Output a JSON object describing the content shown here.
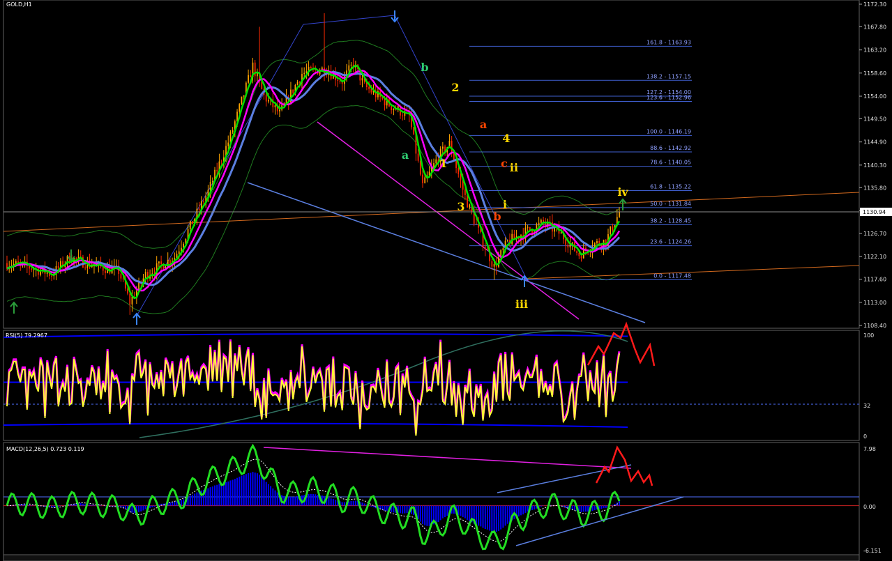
{
  "window": {
    "title": "GOLD,H1"
  },
  "current_price": "1130.94",
  "main": {
    "price_ticks": [
      "1172.30",
      "1167.80",
      "1163.20",
      "1158.60",
      "1154.00",
      "1149.50",
      "1144.90",
      "1140.30",
      "1135.80",
      "1131.20",
      "1126.70",
      "1122.10",
      "1117.60",
      "1113.00",
      "1108.40"
    ],
    "fib_levels": [
      {
        "label": "161.8 - 1163.93",
        "price": 1163.93
      },
      {
        "label": "138.2 - 1157.15",
        "price": 1157.15
      },
      {
        "label": "127.2 - 1154.00",
        "price": 1154.0
      },
      {
        "label": "123.6 - 1152.96",
        "price": 1152.96
      },
      {
        "label": "100.0 - 1146.19",
        "price": 1146.19
      },
      {
        "label": "88.6 - 1142.92",
        "price": 1142.92
      },
      {
        "label": "78.6 - 1140.05",
        "price": 1140.05
      },
      {
        "label": "61.8 - 1135.22",
        "price": 1135.22
      },
      {
        "label": "50.0 - 1131.84",
        "price": 1131.84
      },
      {
        "label": "38.2 - 1128.45",
        "price": 1128.45
      },
      {
        "label": "23.6 - 1124.26",
        "price": 1124.26
      },
      {
        "label": "0.0 - 1117.48",
        "price": 1117.48
      }
    ],
    "wave_labels": [
      {
        "text": "b",
        "color": "#2ecc71"
      },
      {
        "text": "2",
        "color": "#ffd700"
      },
      {
        "text": "a",
        "color": "#2ecc71"
      },
      {
        "text": "1",
        "color": "#ffd700"
      },
      {
        "text": "a",
        "color": "#ff4500"
      },
      {
        "text": "4",
        "color": "#ffd700"
      },
      {
        "text": "c",
        "color": "#ff4500"
      },
      {
        "text": "ii",
        "color": "#ffd700"
      },
      {
        "text": "3",
        "color": "#ffd700"
      },
      {
        "text": "i",
        "color": "#ffd700"
      },
      {
        "text": "b",
        "color": "#ff4500"
      },
      {
        "text": "iii",
        "color": "#ffd700"
      },
      {
        "text": "iv",
        "color": "#ffd700"
      }
    ]
  },
  "rsi": {
    "label": "RSI(5) 79.2967",
    "ticks": [
      "100",
      "32",
      "0"
    ]
  },
  "macd": {
    "label": "MACD(12,26,5) 0.723 0.119",
    "ticks": [
      "7.98",
      "0.00",
      "-6.151"
    ]
  },
  "colors": {
    "background": "#000000",
    "bull_candle": "#ffa500",
    "bear_candle": "#ff2a00",
    "ma_fast": "#00e000",
    "ma_mid": "#ff00ff",
    "ma_slow": "#5b7fe0",
    "envelope": "#1f7a1f",
    "rsi_line": "#ffff33",
    "macd_line": "#22dd22",
    "histogram": "#0000ff",
    "arrow": "#ff1a1a"
  },
  "chart_data": {
    "type": "candlestick",
    "symbol": "GOLD",
    "timeframe": "H1",
    "ylim": [
      1108.4,
      1172.3
    ],
    "close_path": [
      {
        "i": 0,
        "close": 1120.8
      },
      {
        "i": 10,
        "close": 1120.0
      },
      {
        "i": 20,
        "close": 1118.6
      },
      {
        "i": 28,
        "close": 1121.8
      },
      {
        "i": 40,
        "close": 1120.2
      },
      {
        "i": 50,
        "close": 1119.2
      },
      {
        "i": 55,
        "close": 1113.0
      },
      {
        "i": 62,
        "close": 1118.5
      },
      {
        "i": 75,
        "close": 1122.0
      },
      {
        "i": 90,
        "close": 1135.0
      },
      {
        "i": 100,
        "close": 1146.0
      },
      {
        "i": 110,
        "close": 1160.0
      },
      {
        "i": 115,
        "close": 1154.0
      },
      {
        "i": 122,
        "close": 1150.5
      },
      {
        "i": 132,
        "close": 1158.5
      },
      {
        "i": 142,
        "close": 1159.5
      },
      {
        "i": 150,
        "close": 1157.0
      },
      {
        "i": 155,
        "close": 1160.5
      },
      {
        "i": 160,
        "close": 1156.0
      },
      {
        "i": 172,
        "close": 1152.0
      },
      {
        "i": 180,
        "close": 1150.0
      },
      {
        "i": 186,
        "close": 1136.0
      },
      {
        "i": 193,
        "close": 1142.0
      },
      {
        "i": 198,
        "close": 1144.5
      },
      {
        "i": 205,
        "close": 1134.0
      },
      {
        "i": 212,
        "close": 1126.0
      },
      {
        "i": 218,
        "close": 1120.0
      },
      {
        "i": 224,
        "close": 1125.0
      },
      {
        "i": 232,
        "close": 1127.0
      },
      {
        "i": 240,
        "close": 1128.8
      },
      {
        "i": 248,
        "close": 1126.5
      },
      {
        "i": 256,
        "close": 1122.5
      },
      {
        "i": 262,
        "close": 1124.5
      },
      {
        "i": 268,
        "close": 1125.2
      },
      {
        "i": 274,
        "close": 1130.9
      }
    ],
    "oscillators": {
      "rsi_range": [
        0,
        100
      ],
      "rsi_levels": [
        32
      ],
      "macd_range": [
        -6.151,
        7.98
      ]
    }
  }
}
